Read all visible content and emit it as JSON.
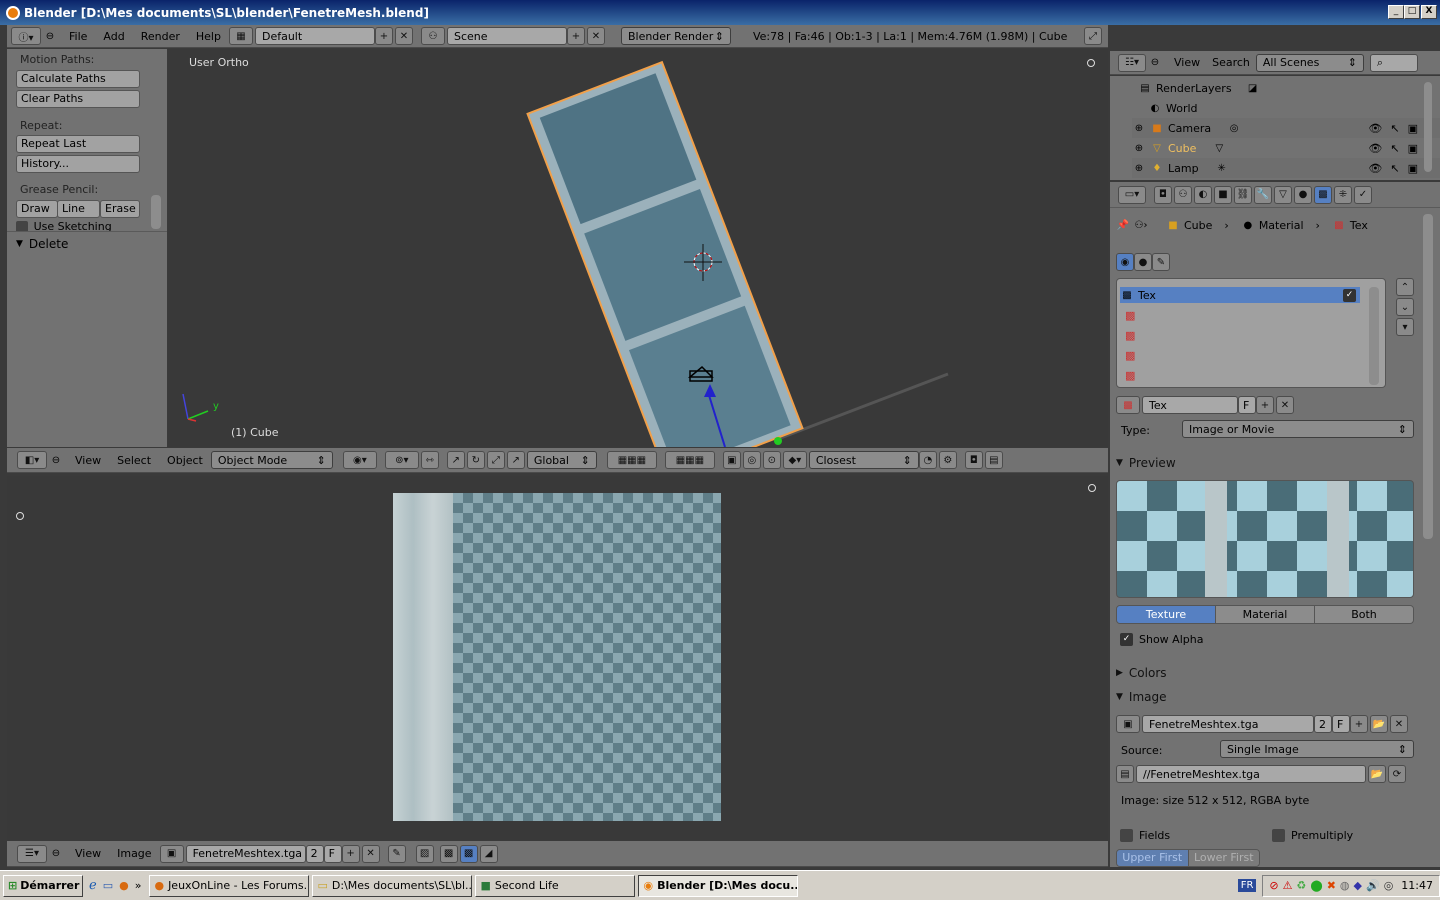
{
  "window": {
    "title": "Blender [D:\\Mes documents\\SL\\blender\\FenetreMesh.blend]",
    "min": "_",
    "max": "□",
    "close": "X"
  },
  "info_header": {
    "menus": [
      "File",
      "Add",
      "Render",
      "Help"
    ],
    "layout": "Default",
    "scene": "Scene",
    "engine": "Blender Render",
    "stats": "Ve:78 | Fa:46 | Ob:1-3 | La:1 | Mem:4.76M (1.98M) | Cube"
  },
  "toolshelf": {
    "motion_paths": "Motion Paths:",
    "calculate_paths": "Calculate Paths",
    "clear_paths": "Clear Paths",
    "repeat": "Repeat:",
    "repeat_last": "Repeat Last",
    "history": "History...",
    "grease_pencil": "Grease Pencil:",
    "draw": "Draw",
    "line": "Line",
    "erase": "Erase",
    "use_sketching": "Use Sketching Sessio",
    "delete": "Delete"
  },
  "viewport": {
    "label": "User Ortho",
    "object": "(1) Cube",
    "axis_y": "y"
  },
  "view3d_header": {
    "menus": [
      "View",
      "Select",
      "Object"
    ],
    "mode": "Object Mode",
    "orientation": "Global",
    "snap": "Closest"
  },
  "image_header": {
    "menus": [
      "View",
      "Image"
    ],
    "image": "FenetreMeshtex.tga",
    "users": "2",
    "fake": "F"
  },
  "outliner": {
    "menus": [
      "View",
      "Search"
    ],
    "filter": "All Scenes",
    "rows": [
      "RenderLayers",
      "World",
      "Camera",
      "Cube",
      "Lamp"
    ]
  },
  "properties": {
    "breadcrumb": [
      "Cube",
      "Material",
      "Tex"
    ],
    "slots": [
      "Tex",
      "",
      "",
      "",
      ""
    ],
    "tex_name": "Tex",
    "tex_fake": "F",
    "type_label": "Type:",
    "type_value": "Image or Movie",
    "preview_label": "Preview",
    "preview_tabs": [
      "Texture",
      "Material",
      "Both"
    ],
    "show_alpha": "Show Alpha",
    "colors_label": "Colors",
    "image_label": "Image",
    "image_name": "FenetreMeshtex.tga",
    "image_users": "2",
    "image_fake": "F",
    "source_label": "Source:",
    "source_value": "Single Image",
    "filepath": "//FenetreMeshtex.tga",
    "image_info": "Image: size 512 x 512, RGBA byte",
    "fields": "Fields",
    "premultiply": "Premultiply",
    "upper_first": "Upper First",
    "lower_first": "Lower First"
  },
  "taskbar": {
    "start": "Démarrer",
    "tasks": [
      "JeuxOnLine - Les Forums...",
      "D:\\Mes documents\\SL\\bl...",
      "Second Life",
      "Blender [D:\\Mes docu..."
    ],
    "lang": "FR",
    "clock": "11:47"
  },
  "colors": {
    "accent": "#5680c2",
    "object_selected": "#f1a04a"
  }
}
